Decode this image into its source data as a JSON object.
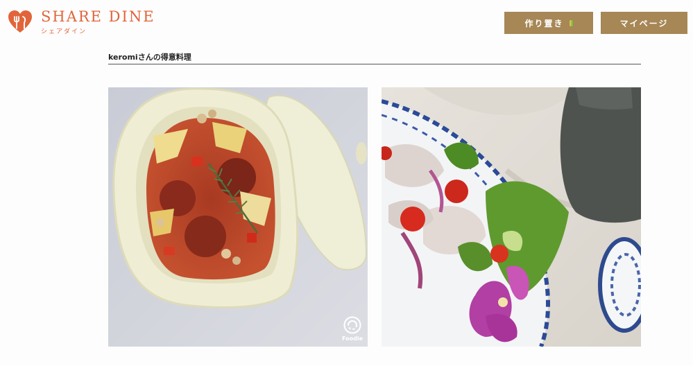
{
  "header": {
    "logo_title": "SHARE DINE",
    "logo_subtitle": "シェアダイン",
    "btn_saku": "作り置き",
    "btn_mypage": "マイページ"
  },
  "section": {
    "title": "keromiさんの得意料理"
  },
  "photos": [
    {
      "watermark": "Foodie"
    },
    {
      "watermark": ""
    }
  ],
  "colors": {
    "brand_orange": "#e2643a",
    "button_gold": "#a68755",
    "divider": "#555555"
  }
}
